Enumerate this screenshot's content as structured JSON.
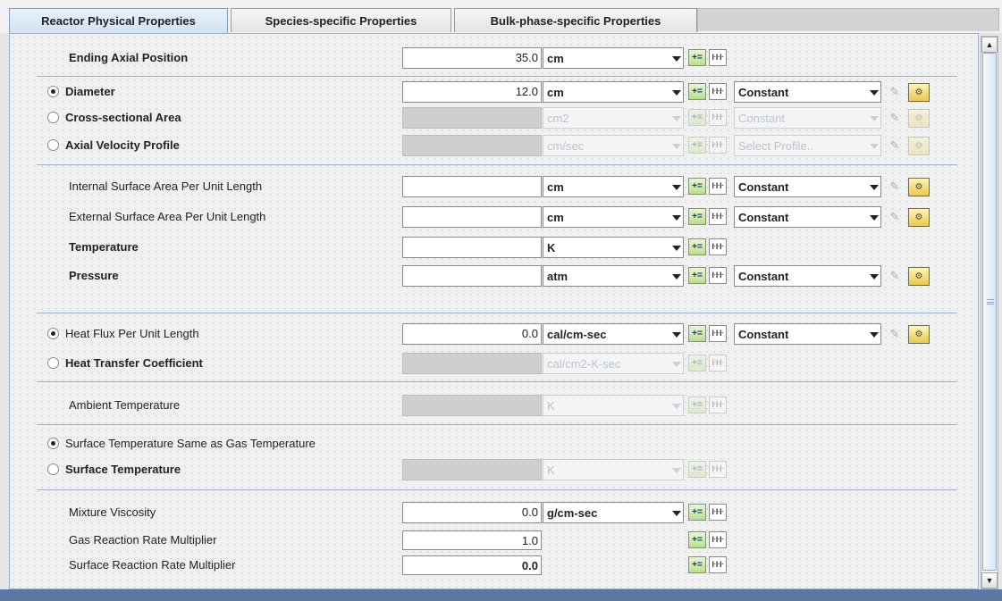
{
  "tabs": [
    {
      "label": "Reactor Physical Properties",
      "active": true
    },
    {
      "label": "Species-specific Properties",
      "active": false
    },
    {
      "label": "Bulk-phase-specific Properties",
      "active": false
    }
  ],
  "rows": {
    "ending_axial_position": {
      "label": "Ending Axial Position",
      "value": "35.0",
      "unit": "cm"
    },
    "diameter": {
      "label": "Diameter",
      "value": "12.0",
      "unit": "cm",
      "profile": "Constant"
    },
    "cross_sectional_area": {
      "label": "Cross-sectional Area",
      "value": "",
      "unit": "cm2",
      "profile": "Constant"
    },
    "axial_velocity_profile": {
      "label": "Axial Velocity Profile",
      "value": "",
      "unit": "cm/sec",
      "profile": "Select Profile.."
    },
    "internal_surface_area": {
      "label": "Internal Surface Area Per Unit Length",
      "value": "",
      "unit": "cm",
      "profile": "Constant"
    },
    "external_surface_area": {
      "label": "External Surface Area Per Unit Length",
      "value": "",
      "unit": "cm",
      "profile": "Constant"
    },
    "temperature": {
      "label": "Temperature",
      "value": "",
      "unit": "K"
    },
    "pressure": {
      "label": "Pressure",
      "value": "",
      "unit": "atm",
      "profile": "Constant"
    },
    "heat_flux": {
      "label": "Heat Flux Per Unit Length",
      "value": "0.0",
      "unit": "cal/cm-sec",
      "profile": "Constant"
    },
    "heat_transfer_coefficient": {
      "label": "Heat Transfer Coefficient",
      "value": "",
      "unit": "cal/cm2-K-sec"
    },
    "ambient_temperature": {
      "label": "Ambient Temperature",
      "value": "",
      "unit": "K"
    },
    "surface_temp_same": {
      "label": "Surface Temperature Same as Gas Temperature"
    },
    "surface_temperature": {
      "label": "Surface Temperature",
      "value": "",
      "unit": "K"
    },
    "mixture_viscosity": {
      "label": "Mixture Viscosity",
      "value": "0.0",
      "unit": "g/cm-sec"
    },
    "gas_reaction_rate_multiplier": {
      "label": "Gas Reaction Rate Multiplier",
      "value": "1.0"
    },
    "surface_reaction_rate_multiplier": {
      "label": "Surface Reaction Rate Multiplier",
      "value": "0.0"
    }
  },
  "radios": {
    "diameter_selected": true,
    "cross_sectional_area_selected": false,
    "axial_velocity_profile_selected": false,
    "heat_flux_selected": true,
    "heat_transfer_coefficient_selected": false,
    "surface_temp_same_selected": true,
    "surface_temperature_selected": false
  },
  "icons": {
    "plus": "add-parameter-icon",
    "tune": "parameter-study-icon",
    "pencil": "pencil-icon",
    "edit": "profile-editor-icon"
  },
  "colors": {
    "accent": "#5a79a5",
    "active_tab": "#d0e2f4",
    "disabled_field": "#cfcfcf"
  }
}
